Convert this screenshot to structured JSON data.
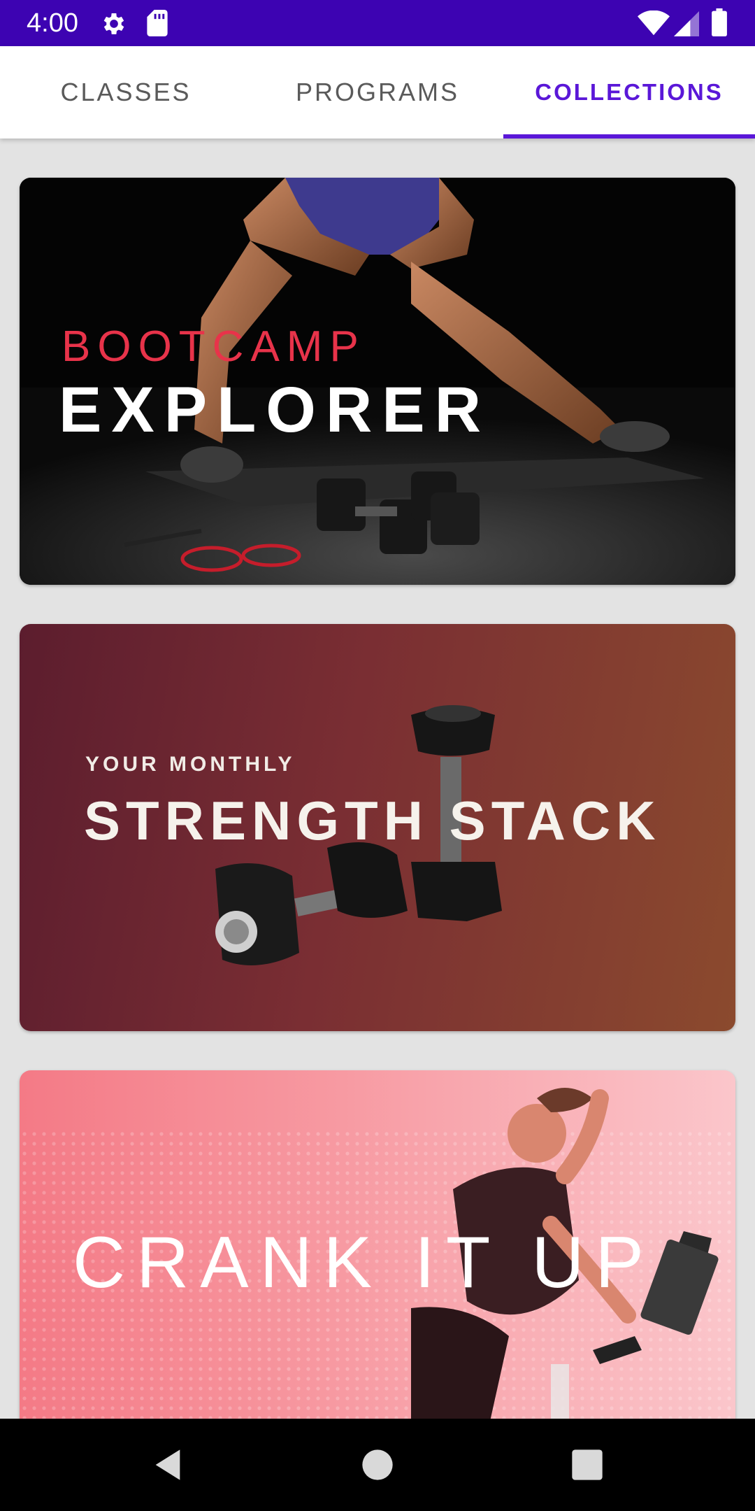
{
  "status_bar": {
    "time": "4:00",
    "icons": [
      "gear-icon",
      "sd-card-icon",
      "wifi-icon",
      "signal-icon",
      "battery-icon"
    ]
  },
  "tabs": [
    {
      "label": "CLASSES",
      "active": false
    },
    {
      "label": "PROGRAMS",
      "active": false
    },
    {
      "label": "COLLECTIONS",
      "active": true
    }
  ],
  "collections": [
    {
      "line1": "BOOTCAMP",
      "line2": "EXPLORER"
    },
    {
      "line1": "YOUR MONTHLY",
      "line2": "STRENGTH STACK"
    },
    {
      "line1": "CRANK IT UP"
    }
  ],
  "nav_bar": {
    "buttons": [
      "back-icon",
      "home-icon",
      "recents-icon"
    ]
  },
  "colors": {
    "status_bar": "#3d03b2",
    "accent": "#5a17d8",
    "bootcamp_red": "#e8334a",
    "background": "#e3e3e3"
  }
}
